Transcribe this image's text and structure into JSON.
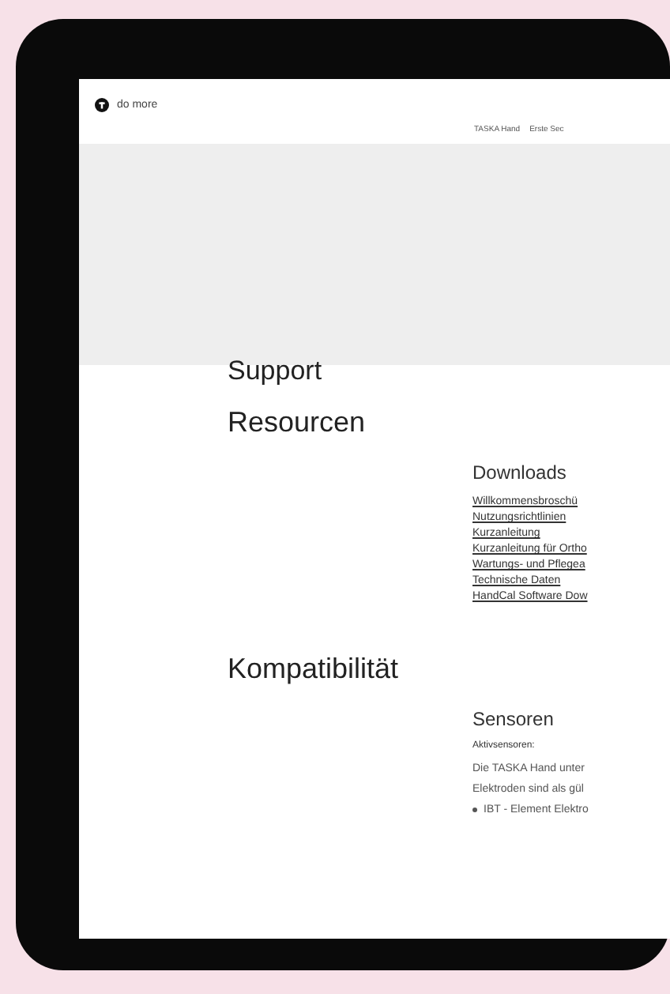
{
  "header": {
    "logo_text": "do more",
    "nav": [
      "TASKA Hand",
      "Erste Sec"
    ]
  },
  "hero": {
    "title": "Support"
  },
  "sections": [
    {
      "title": "Resourcen",
      "subtitle": "Downloads",
      "links": [
        "Willkommensbroschü",
        "Nutzungsrichtlinien",
        "Kurzanleitung",
        "Kurzanleitung für Ortho",
        "Wartungs- und Pflegea",
        "Technische Daten",
        "HandCal Software Dow"
      ]
    },
    {
      "title": "Kompatibilität",
      "subtitle": "Sensoren",
      "label": "Aktivsensoren:",
      "lines": [
        "Die TASKA Hand unter",
        "Elektroden sind als gül"
      ],
      "bullets": [
        "IBT - Element Elektro"
      ]
    }
  ]
}
